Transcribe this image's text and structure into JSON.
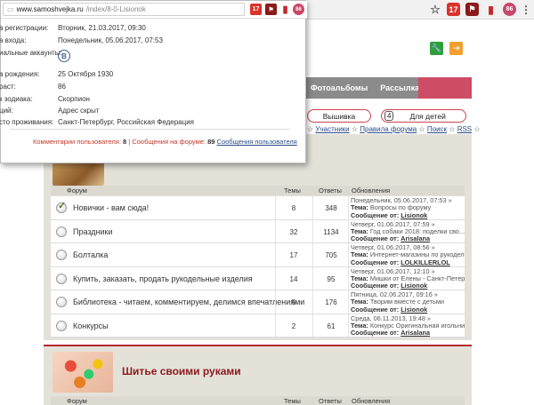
{
  "chrome": {
    "star": "☆",
    "ext1": "17",
    "ext2": "⚑",
    "ext3": "▮",
    "ext4": "86",
    "menu": "⋮"
  },
  "header": {
    "green_btn_icon": "🔧",
    "orange_btn_icon": "⇥"
  },
  "nav": {
    "items": [
      "Фотоальбомы",
      "Рассылка"
    ]
  },
  "categories": {
    "btn1": "Вышивка",
    "btn2_num": "4",
    "btn2": "Для детей"
  },
  "toplinks": {
    "sep": "☆",
    "items": [
      "Участники",
      "Правила форума",
      "Поиск",
      "RSS"
    ]
  },
  "forum1": {
    "headers": {
      "forum": "Форум",
      "topics": "Темы",
      "posts": "Ответы",
      "updates": "Обновления"
    },
    "rows": [
      {
        "title": "Новички - вам сюда!",
        "topics": "8",
        "posts": "348",
        "date": "Понедельник, 05.06.2017, 07:53 »",
        "topic_label": "Тема:",
        "topic": "Вопросы по форуму",
        "msg_label": "Сообщение от:",
        "user": "Lisiоnok",
        "checked": true
      },
      {
        "title": "Праздники",
        "topics": "32",
        "posts": "1134",
        "date": "Четверг, 01.06.2017, 07:59 »",
        "topic_label": "Тема:",
        "topic": "Год собаки 2018: поделки сво...",
        "msg_label": "Сообщение от:",
        "user": "Arisalana",
        "checked": false
      },
      {
        "title": "Болталка",
        "topics": "17",
        "posts": "705",
        "date": "Четверг, 01.06.2017, 08:56 »",
        "topic_label": "Тема:",
        "topic": "Интернет-магазины по рукоделию",
        "msg_label": "Сообщение от:",
        "user": "LOLKILLERLOL",
        "checked": false
      },
      {
        "title": "Купить, заказать, продать рукодельные изделия",
        "topics": "14",
        "posts": "95",
        "date": "Четверг, 01.06.2017, 12:10 »",
        "topic_label": "Тема:",
        "topic": "Мишки от Елены - Санкт-Петер...",
        "msg_label": "Сообщение от:",
        "user": "Lisiоnok",
        "checked": false
      },
      {
        "title": "Библиотека - читаем, комментируем, делимся впечатлениями",
        "topics": "5",
        "posts": "176",
        "date": "Пятница, 02.06.2017, 09:16 »",
        "topic_label": "Тема:",
        "topic": "Творим вместе с детьми",
        "msg_label": "Сообщение от:",
        "user": "Lisiоnok",
        "checked": false
      },
      {
        "title": "Конкурсы",
        "topics": "2",
        "posts": "61",
        "date": "Среда, 06.11.2013, 19:48 »",
        "topic_label": "Тема:",
        "topic": "Конкурс Оригинальная игольница",
        "msg_label": "Сообщение от:",
        "user": "Arisalana",
        "checked": false
      }
    ]
  },
  "forum2": {
    "title": "Шитье своими руками",
    "headers": {
      "forum": "Форум",
      "topics": "Темы",
      "posts": "Ответы",
      "updates": "Обновления"
    }
  },
  "popup": {
    "url_host": "www.samoshvejka.ru",
    "url_path": "/index/8-0-Lisionok",
    "ext1": "17",
    "ext2": "⚑",
    "ext3": "▮",
    "ext4": "86",
    "fields": [
      {
        "label": "а регистрации:",
        "value": "Вторник, 21.03.2017, 09:30"
      },
      {
        "label": "а входа:",
        "value": "Понедельник, 05.06.2017, 07:53"
      },
      {
        "label": "иальные аккаунты:",
        "value": ""
      },
      {
        "label": "а рождения:",
        "value": "25 Октября 1930"
      },
      {
        "label": "раст:",
        "value": "86"
      },
      {
        "label": "к зодиака:",
        "value": "Скорпион"
      },
      {
        "label": "ций:",
        "value": "Адрес скрыт"
      },
      {
        "label": "сто проживания:",
        "value": "Санкт-Петербург, Российская Федерация"
      }
    ],
    "vk": "В",
    "stats": {
      "comments_label": "Комментарии пользователя:",
      "comments": "8",
      "sep": "|",
      "forum_label": "Сообщения на форуме:",
      "forum": "89",
      "link": "Сообщения пользователя"
    }
  }
}
